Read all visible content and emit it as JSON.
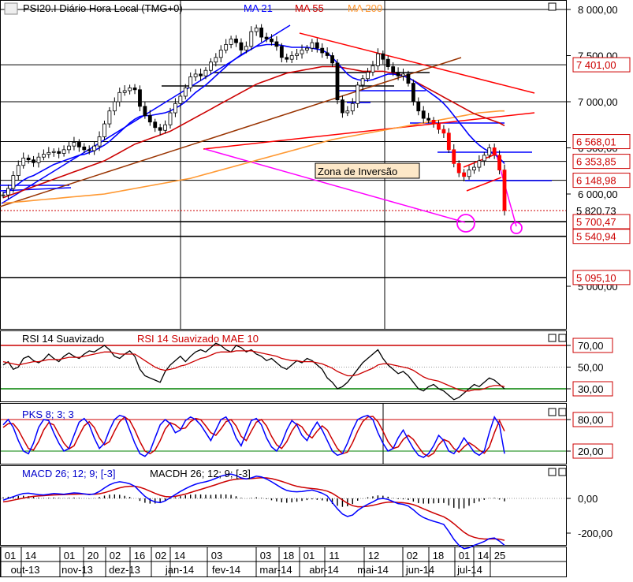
{
  "chart_data": {
    "type": "line",
    "main": {
      "title": "PSI20.I Diário Hora Local (TMG+0)",
      "legend": [
        {
          "name": "MA 21",
          "color": "#0000ff"
        },
        {
          "name": "MA 55",
          "color": "#cc0000"
        },
        {
          "name": "MA 200",
          "color": "#ff9933"
        }
      ],
      "ylim": [
        4900,
        8100
      ],
      "y_ticks": [
        {
          "v": 8000,
          "label": "8 000,00"
        },
        {
          "v": 7500,
          "label": "7 500,00"
        },
        {
          "v": 7000,
          "label": "7 000,00"
        },
        {
          "v": 6500,
          "label": "6 500,00"
        },
        {
          "v": 6000,
          "label": "6 000,00"
        },
        {
          "v": 5000,
          "label": "5 000,00"
        }
      ],
      "price_tags": [
        {
          "v": 7401.0,
          "label": "7 401,00"
        },
        {
          "v": 6568.01,
          "label": "6 568,01"
        },
        {
          "v": 6353.85,
          "label": "6 353,85"
        },
        {
          "v": 6148.98,
          "label": "6 148,98"
        },
        {
          "v": 5820.73,
          "label": "5 820,73"
        },
        {
          "v": 5700.47,
          "label": "5 700,47"
        },
        {
          "v": 5540.94,
          "label": "5 540,94"
        },
        {
          "v": 5095.1,
          "label": "5 095,10"
        }
      ],
      "annotation": "Zona de  Inversão",
      "close_series": [
        5990,
        6060,
        6200,
        6310,
        6390,
        6370,
        6340,
        6400,
        6430,
        6450,
        6460,
        6440,
        6480,
        6520,
        6560,
        6510,
        6480,
        6470,
        6520,
        6620,
        6760,
        6900,
        7000,
        7100,
        7120,
        7150,
        7130,
        6950,
        6850,
        6780,
        6720,
        6690,
        6750,
        6880,
        6980,
        7060,
        7150,
        7270,
        7300,
        7280,
        7340,
        7430,
        7480,
        7560,
        7620,
        7680,
        7640,
        7560,
        7600,
        7760,
        7800,
        7700,
        7680,
        7650,
        7600,
        7480,
        7460,
        7500,
        7520,
        7560,
        7580,
        7640,
        7580,
        7530,
        7500,
        7420,
        7020,
        6880,
        6900,
        6980,
        7180,
        7250,
        7320,
        7390,
        7520,
        7460,
        7380,
        7320,
        7280,
        7300,
        7200,
        7000,
        6900,
        6820,
        6800,
        6760,
        6700,
        6660,
        6480,
        6330,
        6230,
        6190,
        6260,
        6290,
        6360,
        6420,
        6500,
        6420,
        6260,
        5820
      ],
      "ma21": [
        6010,
        6030,
        6070,
        6110,
        6150,
        6180,
        6200,
        6230,
        6260,
        6290,
        6320,
        6340,
        6360,
        6380,
        6400,
        6420,
        6430,
        6450,
        6470,
        6500,
        6530,
        6570,
        6620,
        6670,
        6720,
        6770,
        6810,
        6840,
        6850,
        6850,
        6860,
        6870,
        6880,
        6900,
        6930,
        6960,
        7000,
        7050,
        7100,
        7140,
        7180,
        7230,
        7280,
        7330,
        7380,
        7430,
        7470,
        7510,
        7540,
        7570,
        7600,
        7610,
        7620,
        7620,
        7620,
        7610,
        7600,
        7590,
        7590,
        7590,
        7590,
        7580,
        7570,
        7560,
        7530,
        7480,
        7420,
        7360,
        7300,
        7260,
        7240,
        7230,
        7230,
        7240,
        7260,
        7280,
        7300,
        7300,
        7290,
        7280,
        7260,
        7230,
        7190,
        7150,
        7110,
        7070,
        7030,
        6980,
        6920,
        6850,
        6780,
        6710,
        6640,
        6580,
        6530,
        6490,
        6460,
        6430,
        6390,
        6330
      ],
      "ma55": [
        5960,
        5980,
        6000,
        6020,
        6040,
        6060,
        6080,
        6100,
        6120,
        6140,
        6160,
        6180,
        6200,
        6220,
        6240,
        6260,
        6280,
        6300,
        6320,
        6340,
        6360,
        6390,
        6420,
        6450,
        6480,
        6510,
        6540,
        6560,
        6580,
        6600,
        6620,
        6640,
        6660,
        6680,
        6710,
        6740,
        6770,
        6800,
        6830,
        6860,
        6890,
        6920,
        6950,
        6980,
        7010,
        7040,
        7070,
        7100,
        7130,
        7160,
        7190,
        7210,
        7230,
        7250,
        7270,
        7290,
        7310,
        7320,
        7330,
        7340,
        7350,
        7360,
        7370,
        7380,
        7380,
        7380,
        7380,
        7370,
        7360,
        7350,
        7340,
        7330,
        7330,
        7330,
        7330,
        7330,
        7320,
        7310,
        7300,
        7280,
        7260,
        7230,
        7200,
        7170,
        7140,
        7110,
        7080,
        7050,
        7020,
        6990,
        6960,
        6930,
        6900,
        6870,
        6850,
        6830,
        6810,
        6790,
        6770,
        6740
      ],
      "ma200": [
        5900,
        5905,
        5910,
        5915,
        5920,
        5925,
        5930,
        5935,
        5940,
        5945,
        5950,
        5955,
        5960,
        5965,
        5970,
        5975,
        5980,
        5985,
        5990,
        5995,
        6000,
        6010,
        6020,
        6030,
        6040,
        6050,
        6060,
        6070,
        6080,
        6090,
        6100,
        6110,
        6120,
        6130,
        6140,
        6150,
        6160,
        6170,
        6185,
        6200,
        6215,
        6230,
        6245,
        6260,
        6275,
        6290,
        6305,
        6320,
        6335,
        6350,
        6365,
        6380,
        6395,
        6410,
        6425,
        6440,
        6455,
        6470,
        6485,
        6500,
        6515,
        6530,
        6545,
        6560,
        6575,
        6590,
        6600,
        6610,
        6620,
        6630,
        6640,
        6650,
        6660,
        6670,
        6680,
        6690,
        6700,
        6710,
        6720,
        6730,
        6740,
        6750,
        6760,
        6770,
        6780,
        6790,
        6800,
        6810,
        6820,
        6830,
        6840,
        6850,
        6860,
        6870,
        6880,
        6885,
        6890,
        6895,
        6900,
        6900
      ]
    },
    "rsi": {
      "title": "RSI 14 Suavizado",
      "title2": "RSI 14 Suavizado MAE 10",
      "ylim": [
        10,
        85
      ],
      "y_ticks": [
        {
          "v": 70,
          "label": "70,00"
        },
        {
          "v": 50,
          "label": "50,00"
        },
        {
          "v": 30,
          "label": "30,00"
        }
      ],
      "values": [
        52,
        55,
        48,
        50,
        58,
        60,
        56,
        54,
        57,
        62,
        58,
        55,
        60,
        63,
        60,
        58,
        62,
        65,
        64,
        67,
        70,
        66,
        60,
        58,
        62,
        65,
        60,
        48,
        42,
        40,
        38,
        36,
        46,
        52,
        56,
        60,
        55,
        60,
        64,
        66,
        64,
        68,
        72,
        70,
        66,
        64,
        70,
        68,
        64,
        66,
        62,
        60,
        56,
        58,
        54,
        50,
        48,
        52,
        56,
        54,
        58,
        56,
        52,
        48,
        40,
        36,
        30,
        32,
        36,
        42,
        48,
        54,
        58,
        62,
        66,
        58,
        52,
        48,
        44,
        46,
        42,
        36,
        30,
        28,
        32,
        34,
        30,
        28,
        24,
        20,
        22,
        26,
        30,
        34,
        32,
        36,
        40,
        38,
        34,
        30
      ],
      "signal": [
        55,
        54,
        53,
        52,
        53,
        54,
        55,
        55,
        56,
        57,
        57,
        57,
        58,
        59,
        59,
        59,
        60,
        61,
        62,
        63,
        64,
        64,
        63,
        62,
        62,
        62,
        62,
        59,
        56,
        53,
        50,
        48,
        47,
        48,
        49,
        51,
        52,
        54,
        56,
        58,
        59,
        61,
        63,
        64,
        64,
        64,
        65,
        65,
        65,
        65,
        64,
        63,
        62,
        61,
        60,
        58,
        57,
        56,
        56,
        55,
        55,
        55,
        54,
        53,
        51,
        49,
        46,
        44,
        42,
        42,
        43,
        45,
        47,
        49,
        52,
        53,
        53,
        52,
        51,
        50,
        49,
        47,
        44,
        41,
        39,
        38,
        37,
        35,
        33,
        31,
        29,
        28,
        28,
        29,
        29,
        30,
        32,
        33,
        33,
        32
      ]
    },
    "stoch": {
      "title": "PKS 8; 3; 3",
      "ylim": [
        0,
        100
      ],
      "y_ticks": [
        {
          "v": 80,
          "label": "80,00"
        },
        {
          "v": 20,
          "label": "20,00"
        }
      ],
      "k": [
        70,
        80,
        65,
        40,
        20,
        15,
        35,
        65,
        80,
        78,
        55,
        35,
        20,
        25,
        50,
        75,
        82,
        70,
        45,
        25,
        35,
        60,
        80,
        88,
        85,
        60,
        35,
        15,
        10,
        20,
        45,
        70,
        80,
        72,
        55,
        60,
        78,
        85,
        80,
        70,
        55,
        40,
        60,
        80,
        85,
        70,
        45,
        30,
        55,
        78,
        82,
        70,
        45,
        28,
        20,
        35,
        60,
        78,
        70,
        50,
        40,
        60,
        75,
        60,
        40,
        20,
        12,
        15,
        35,
        60,
        80,
        85,
        88,
        80,
        55,
        35,
        20,
        25,
        45,
        60,
        42,
        25,
        12,
        8,
        15,
        30,
        50,
        40,
        20,
        15,
        28,
        45,
        32,
        18,
        12,
        20,
        55,
        85,
        70,
        15
      ],
      "d": [
        65,
        72,
        72,
        60,
        42,
        25,
        22,
        38,
        60,
        74,
        70,
        52,
        35,
        24,
        30,
        50,
        68,
        76,
        65,
        45,
        32,
        38,
        58,
        76,
        85,
        78,
        60,
        38,
        20,
        15,
        22,
        40,
        62,
        74,
        70,
        62,
        64,
        76,
        82,
        80,
        68,
        55,
        50,
        62,
        76,
        80,
        68,
        48,
        40,
        58,
        75,
        80,
        68,
        48,
        32,
        25,
        38,
        58,
        72,
        66,
        52,
        45,
        58,
        68,
        60,
        42,
        25,
        15,
        18,
        36,
        58,
        76,
        85,
        86,
        76,
        58,
        38,
        25,
        28,
        42,
        50,
        42,
        28,
        15,
        10,
        16,
        32,
        42,
        38,
        25,
        18,
        28,
        36,
        30,
        22,
        16,
        28,
        55,
        78,
        58
      ]
    },
    "macd": {
      "title": "MACD 26; 12; 9; [-3]",
      "title2": "MACDH 26; 12; 9; [-3]",
      "ylim": [
        -320,
        180
      ],
      "y_ticks": [
        {
          "v": 0,
          "label": "0,00"
        },
        {
          "v": -200,
          "label": "-200,00"
        }
      ],
      "macd": [
        -10,
        0,
        10,
        20,
        28,
        30,
        26,
        22,
        20,
        24,
        28,
        26,
        24,
        28,
        32,
        30,
        26,
        22,
        26,
        40,
        60,
        78,
        90,
        96,
        92,
        84,
        70,
        40,
        12,
        -8,
        -20,
        -24,
        -14,
        4,
        22,
        40,
        56,
        70,
        82,
        90,
        96,
        104,
        116,
        128,
        136,
        140,
        132,
        118,
        112,
        118,
        128,
        124,
        112,
        96,
        78,
        60,
        46,
        40,
        38,
        40,
        44,
        48,
        40,
        30,
        14,
        -24,
        -60,
        -90,
        -104,
        -96,
        -70,
        -50,
        -34,
        -20,
        -4,
        0,
        -6,
        -18,
        -30,
        -34,
        -44,
        -66,
        -92,
        -110,
        -122,
        -132,
        -140,
        -150,
        -190,
        -236,
        -270,
        -290,
        -284,
        -270,
        -260,
        -248,
        -232,
        -228,
        -246,
        -270
      ],
      "signal": [
        -20,
        -16,
        -10,
        -4,
        2,
        8,
        12,
        14,
        16,
        18,
        20,
        21,
        22,
        23,
        24,
        25,
        25,
        24,
        24,
        27,
        33,
        42,
        52,
        61,
        67,
        70,
        70,
        64,
        54,
        42,
        29,
        18,
        11,
        9,
        12,
        18,
        25,
        34,
        43,
        52,
        61,
        70,
        79,
        89,
        98,
        106,
        111,
        113,
        113,
        114,
        117,
        119,
        118,
        114,
        107,
        98,
        88,
        78,
        70,
        64,
        60,
        57,
        54,
        49,
        42,
        29,
        11,
        -9,
        -28,
        -42,
        -48,
        -48,
        -45,
        -40,
        -33,
        -26,
        -22,
        -21,
        -23,
        -25,
        -29,
        -36,
        -47,
        -60,
        -72,
        -84,
        -95,
        -106,
        -123,
        -146,
        -171,
        -195,
        -213,
        -224,
        -231,
        -234,
        -234,
        -233,
        -235,
        -242
      ],
      "histogram": [
        10,
        16,
        20,
        24,
        26,
        22,
        14,
        8,
        4,
        6,
        8,
        5,
        2,
        5,
        8,
        5,
        1,
        -2,
        2,
        13,
        27,
        36,
        38,
        35,
        25,
        14,
        0,
        -24,
        -42,
        -50,
        -49,
        -42,
        -25,
        -5,
        10,
        22,
        31,
        36,
        39,
        38,
        35,
        34,
        37,
        39,
        38,
        34,
        21,
        5,
        -1,
        4,
        11,
        5,
        -6,
        -18,
        -29,
        -38,
        -42,
        -38,
        -32,
        -24,
        -16,
        -9,
        -14,
        -19,
        -28,
        -53,
        -71,
        -81,
        -76,
        -54,
        -22,
        -2,
        11,
        20,
        29,
        26,
        16,
        3,
        -7,
        -9,
        -15,
        -30,
        -45,
        -50,
        -50,
        -48,
        -45,
        -44,
        -67,
        -90,
        -99,
        -95,
        -71,
        -46,
        -29,
        -14,
        2,
        5,
        -11,
        -28
      ]
    },
    "x_axis": {
      "day_labels": [
        "01",
        "14",
        "01",
        "20",
        "02",
        "16",
        "02",
        "14",
        "03",
        "03",
        "18",
        "01",
        "11",
        "12",
        "02",
        "18",
        "01",
        "14",
        "25"
      ],
      "month_labels": [
        "out-13",
        "nov-13",
        "dez-13",
        "jan-14",
        "fev-14",
        "mar-14",
        "abr-14",
        "mai-14",
        "jun-14",
        "jul-14"
      ]
    }
  }
}
